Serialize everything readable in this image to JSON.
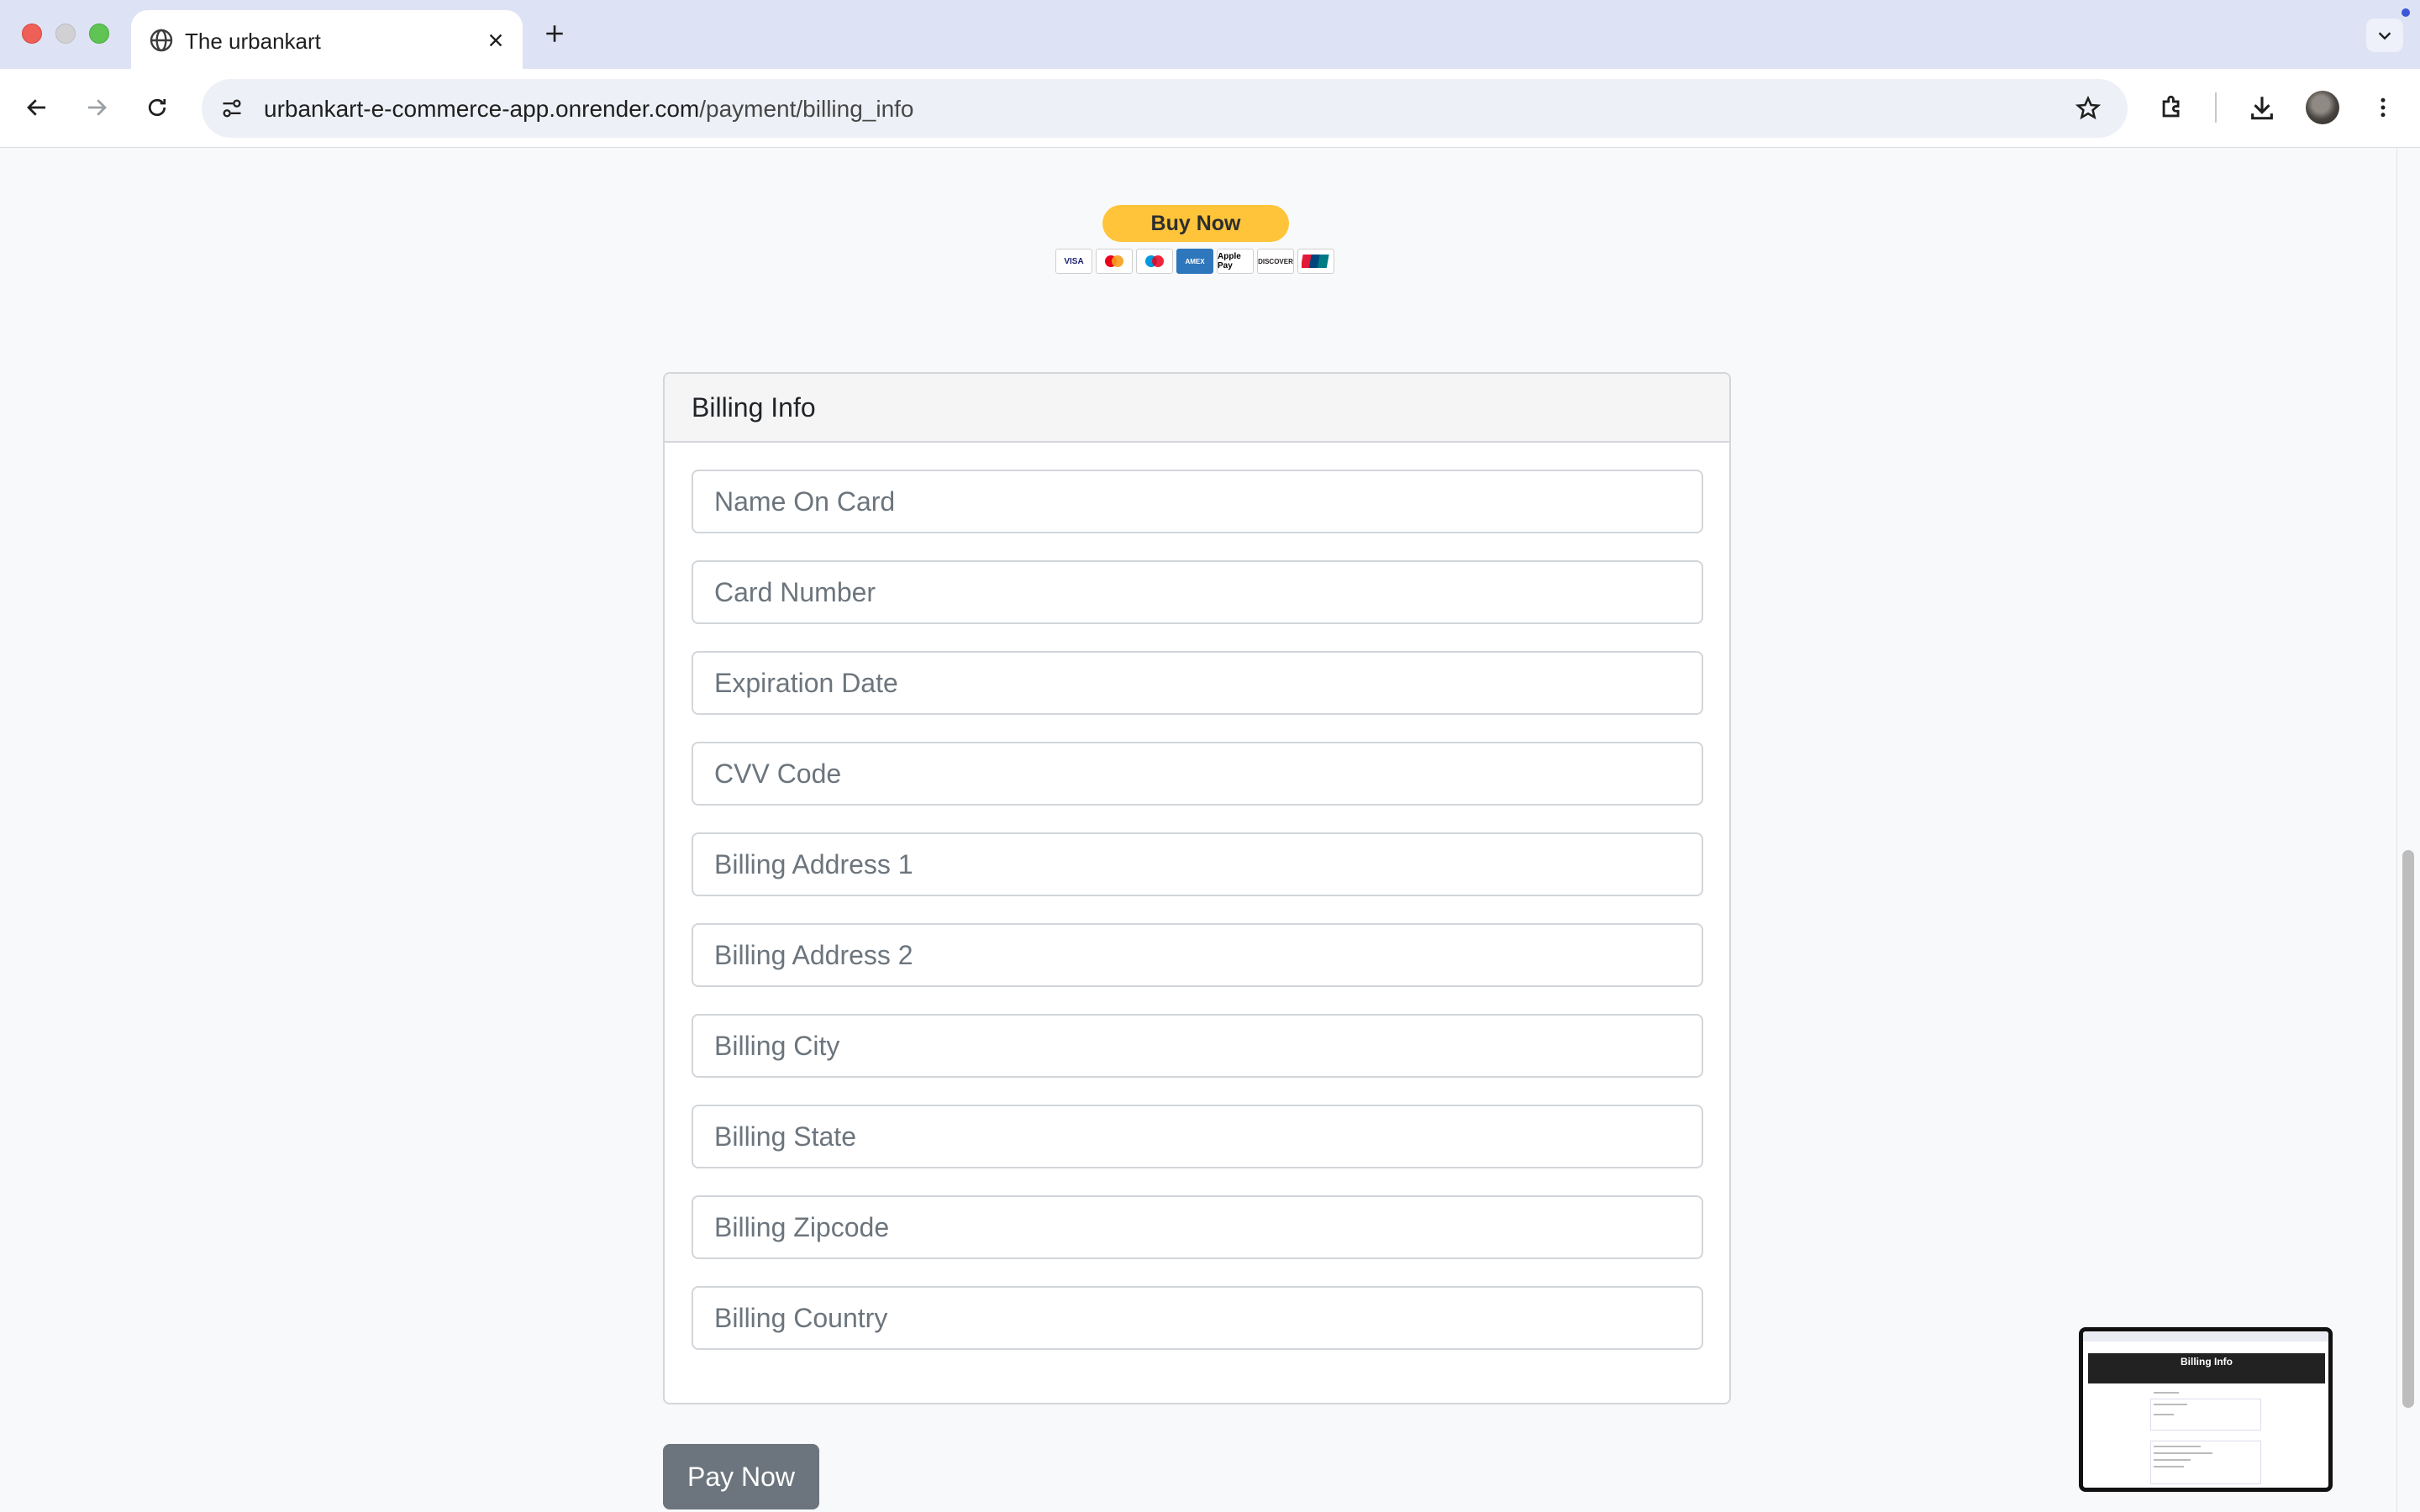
{
  "browser": {
    "tab_title": "The urbankart",
    "url_host": "urbankart-e-commerce-app.onrender.com",
    "url_path": "/payment/billing_info"
  },
  "paypal": {
    "button_label": "Buy Now",
    "card_logos": [
      "VISA",
      "Mastercard",
      "Maestro",
      "AMEX",
      "Apple Pay",
      "DISCOVER",
      "UnionPay"
    ]
  },
  "billing": {
    "title": "Billing Info",
    "fields": [
      {
        "name": "name-on-card-input",
        "placeholder": "Name On Card"
      },
      {
        "name": "card-number-input",
        "placeholder": "Card Number"
      },
      {
        "name": "expiration-date-input",
        "placeholder": "Expiration Date"
      },
      {
        "name": "cvv-code-input",
        "placeholder": "CVV Code"
      },
      {
        "name": "billing-address-1-input",
        "placeholder": "Billing Address 1"
      },
      {
        "name": "billing-address-2-input",
        "placeholder": "Billing Address 2"
      },
      {
        "name": "billing-city-input",
        "placeholder": "Billing City"
      },
      {
        "name": "billing-state-input",
        "placeholder": "Billing State"
      },
      {
        "name": "billing-zipcode-input",
        "placeholder": "Billing Zipcode"
      },
      {
        "name": "billing-country-input",
        "placeholder": "Billing Country"
      }
    ],
    "submit_label": "Pay Now"
  },
  "thumbnail": {
    "title": "Billing Info"
  },
  "colors": {
    "paypal_yellow": "#ffc43a",
    "pay_now_button": "#6c757d",
    "page_background": "#f8f9fa"
  }
}
